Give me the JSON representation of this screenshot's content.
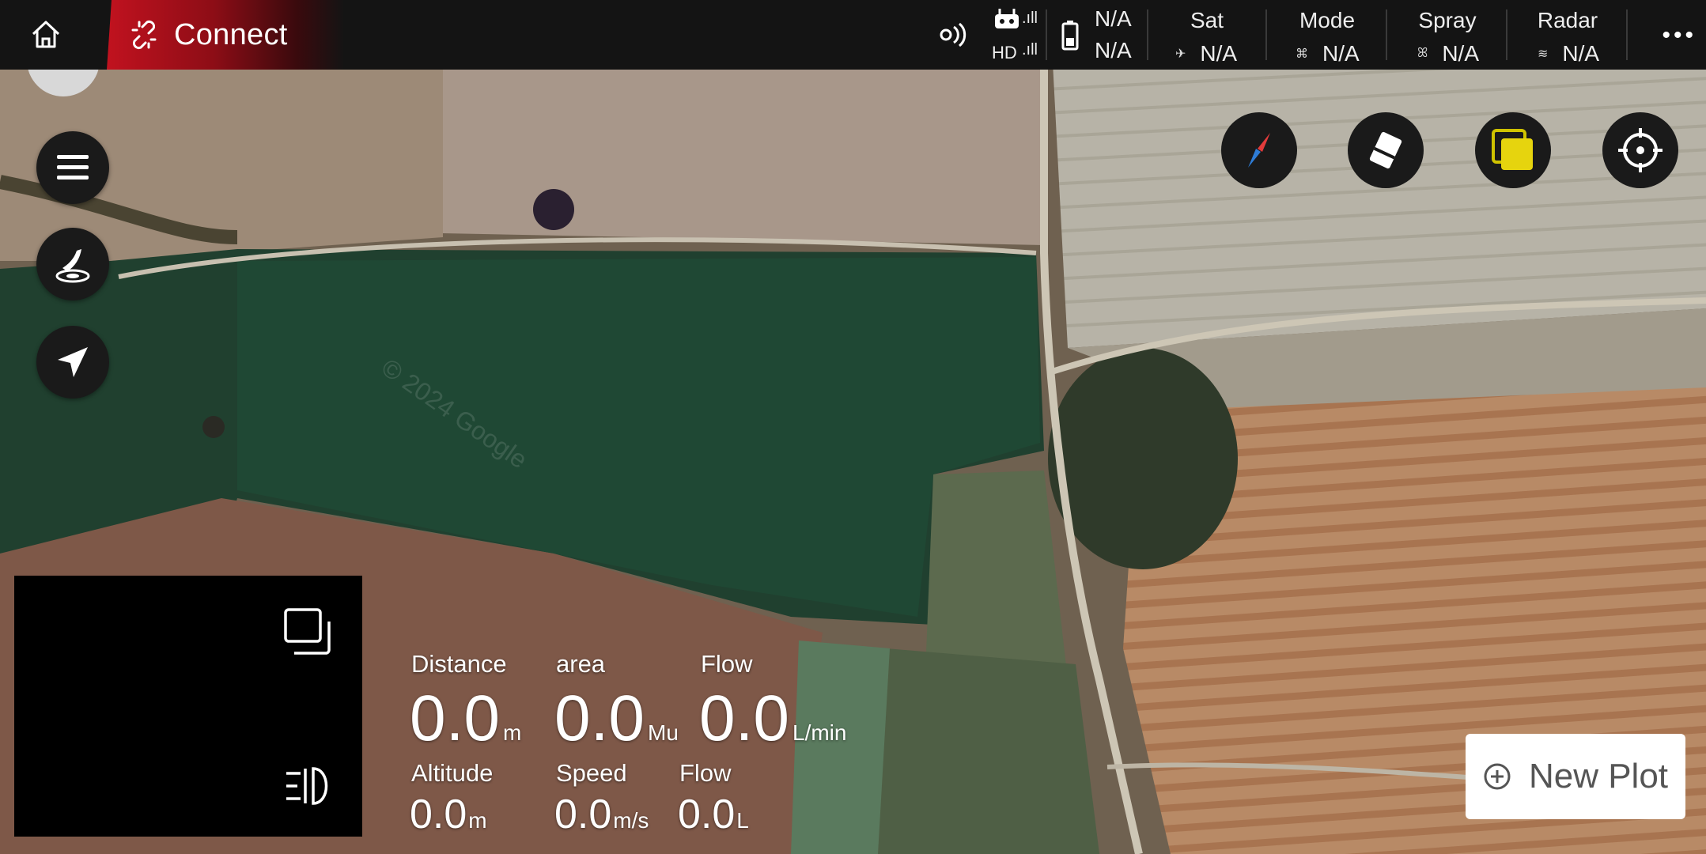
{
  "app": {
    "connect_label": "Connect"
  },
  "status_bar": {
    "hd_label": "HD",
    "battery_top": "N/A",
    "battery_bottom": "N/A",
    "sat": {
      "label": "Sat",
      "value": "N/A",
      "icon": "satellite-icon"
    },
    "mode": {
      "label": "Mode",
      "value": "N/A",
      "icon": "drone-icon"
    },
    "spray": {
      "label": "Spray",
      "value": "N/A",
      "icon": "spray-icon"
    },
    "radar": {
      "label": "Radar",
      "value": "N/A",
      "icon": "radar-icon"
    },
    "more_label": "•••"
  },
  "telemetry": {
    "distance": {
      "label": "Distance",
      "value": "0.0",
      "unit": "m"
    },
    "area": {
      "label": "area",
      "value": "0.0",
      "unit": "Mu"
    },
    "flow_rate": {
      "label": "Flow",
      "value": "0.0",
      "unit": "L/min"
    },
    "altitude": {
      "label": "Altitude",
      "value": "0.0",
      "unit": "m"
    },
    "speed": {
      "label": "Speed",
      "value": "0.0",
      "unit": "m/s"
    },
    "flow_total": {
      "label": "Flow",
      "value": "0.0",
      "unit": "L"
    }
  },
  "actions": {
    "new_plot_label": "New Plot"
  },
  "map": {
    "watermark": "© 2024 Google"
  },
  "colors": {
    "accent": "#c1121f",
    "map_tool_yellow": "#e6d40e",
    "compass_blue": "#2e7cd6",
    "compass_red": "#e23b3b"
  }
}
